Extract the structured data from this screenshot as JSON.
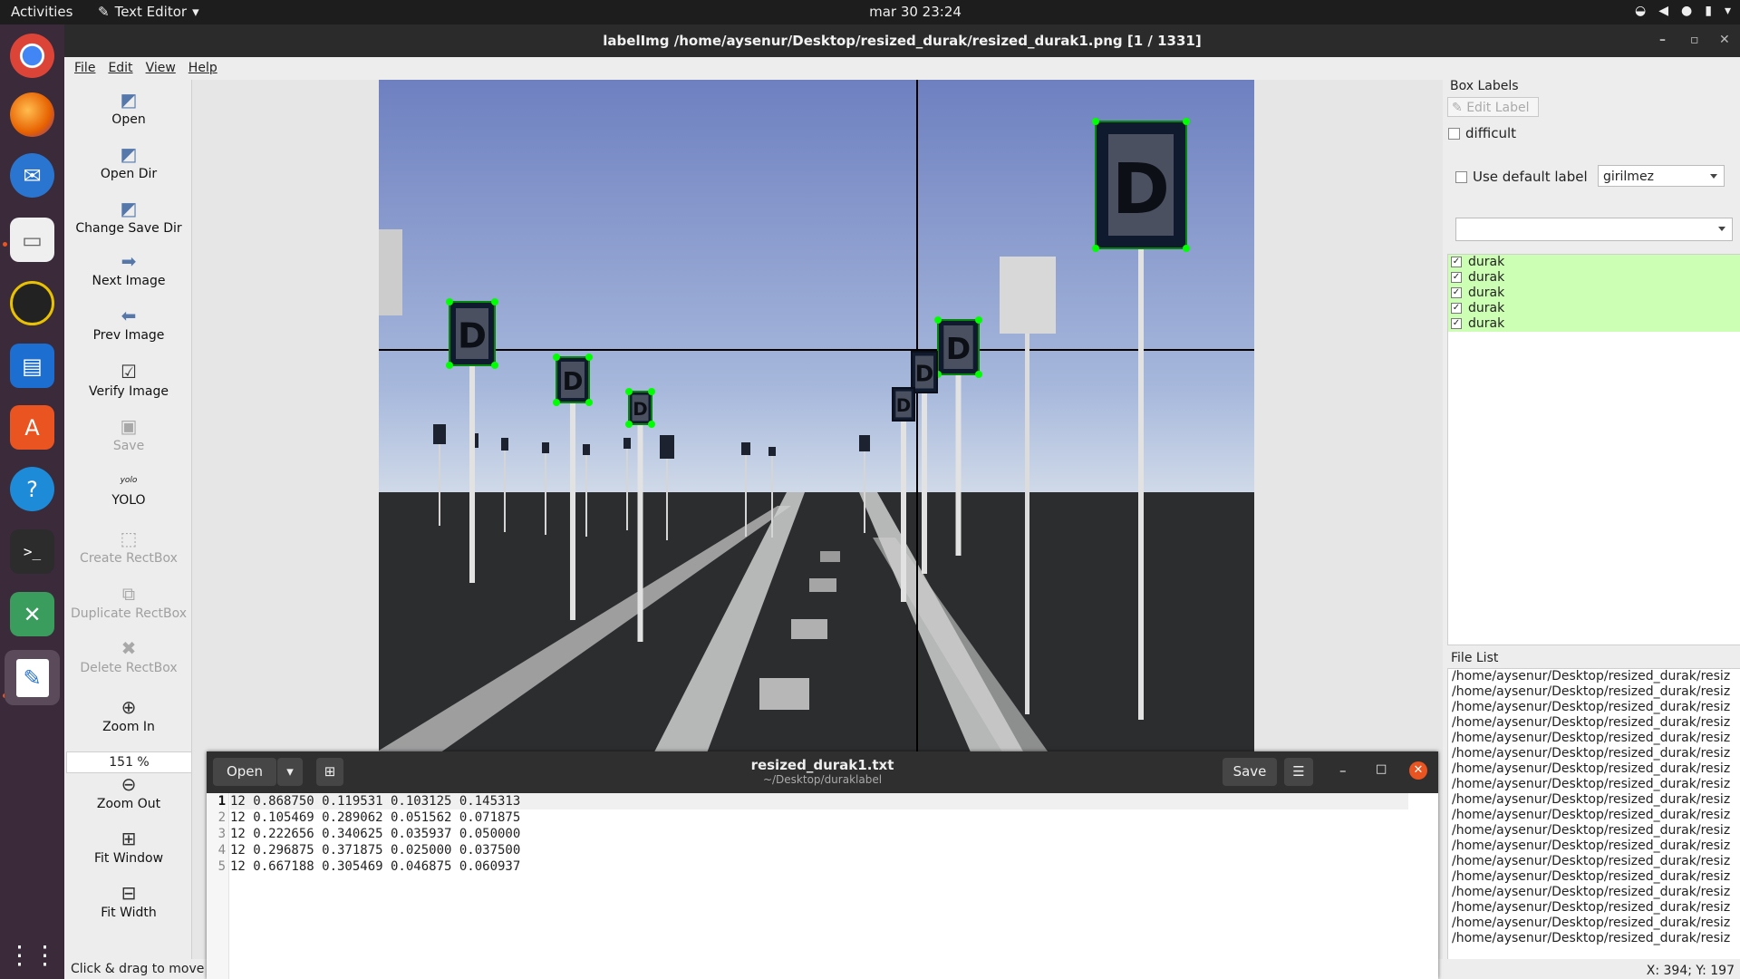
{
  "topbar": {
    "activities": "Activities",
    "app_name": "Text Editor",
    "clock": "mar 30  23:24"
  },
  "labelimg": {
    "window_title": "labelImg /home/aysenur/Desktop/resized_durak/resized_durak1.png [1 / 1331]",
    "menu": [
      "File",
      "Edit",
      "View",
      "Help"
    ],
    "toolbar": {
      "open": "Open",
      "open_dir": "Open Dir",
      "change_save_dir": "Change Save Dir",
      "next_image": "Next Image",
      "prev_image": "Prev Image",
      "verify_image": "Verify Image",
      "save": "Save",
      "format_icon": "yolo",
      "format": "YOLO",
      "create_rectbox": "Create RectBox",
      "duplicate_rectbox": "Duplicate RectBox",
      "delete_rectbox": "Delete RectBox",
      "zoom_in": "Zoom In",
      "zoom_value": "151 %",
      "zoom_out": "Zoom Out",
      "fit_window": "Fit Window",
      "fit_width": "Fit Width"
    },
    "status": "Click & drag to move p",
    "coords": "X: 394; Y: 197",
    "right_panel": {
      "box_labels_title": "Box Labels",
      "edit_label": "Edit Label",
      "difficult": "difficult",
      "use_default_label": "Use default label",
      "default_label_value": "girilmez",
      "labels": [
        "durak",
        "durak",
        "durak",
        "durak",
        "durak"
      ],
      "file_list_title": "File List",
      "files": [
        "/home/aysenur/Desktop/resized_durak/resiz",
        "/home/aysenur/Desktop/resized_durak/resiz",
        "/home/aysenur/Desktop/resized_durak/resiz",
        "/home/aysenur/Desktop/resized_durak/resiz",
        "/home/aysenur/Desktop/resized_durak/resiz",
        "/home/aysenur/Desktop/resized_durak/resiz",
        "/home/aysenur/Desktop/resized_durak/resiz",
        "/home/aysenur/Desktop/resized_durak/resiz",
        "/home/aysenur/Desktop/resized_durak/resiz",
        "/home/aysenur/Desktop/resized_durak/resiz",
        "/home/aysenur/Desktop/resized_durak/resiz",
        "/home/aysenur/Desktop/resized_durak/resiz",
        "/home/aysenur/Desktop/resized_durak/resiz",
        "/home/aysenur/Desktop/resized_durak/resiz",
        "/home/aysenur/Desktop/resized_durak/resiz",
        "/home/aysenur/Desktop/resized_durak/resiz",
        "/home/aysenur/Desktop/resized_durak/resiz",
        "/home/aysenur/Desktop/resized_durak/resiz"
      ]
    },
    "sign_letter": "D"
  },
  "gedit": {
    "open_label": "Open",
    "title": "resized_durak1.txt",
    "subtitle": "~/Desktop/duraklabel",
    "save_label": "Save",
    "lines": [
      "12 0.868750 0.119531 0.103125 0.145313",
      "12 0.105469 0.289062 0.051562 0.071875",
      "12 0.222656 0.340625 0.035937 0.050000",
      "12 0.296875 0.371875 0.025000 0.037500",
      "12 0.667188 0.305469 0.046875 0.060937"
    ],
    "line_numbers": [
      "1",
      "2",
      "3",
      "4",
      "5"
    ]
  },
  "colors": {
    "label_highlight": "#ccffb3",
    "box_handle": "#00ff00",
    "accent": "#e95420"
  }
}
